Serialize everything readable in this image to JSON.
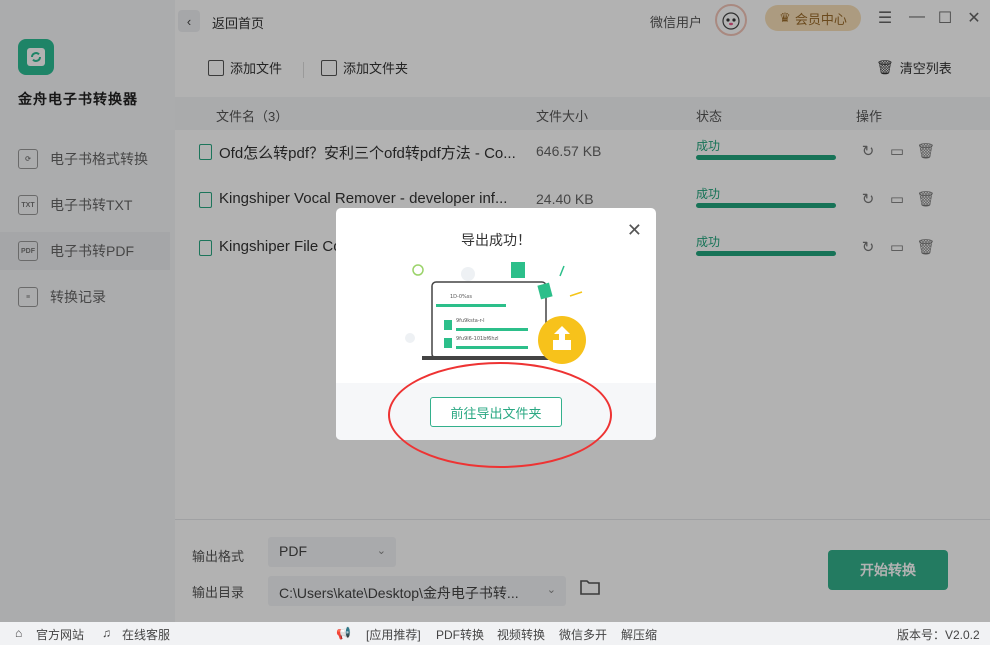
{
  "app": {
    "name": "金舟电子书转换器"
  },
  "sidebar": {
    "items": [
      {
        "label": "电子书格式转换",
        "icon": "refresh-doc-icon"
      },
      {
        "label": "电子书转TXT",
        "icon": "txt-icon",
        "badge": "TXT"
      },
      {
        "label": "电子书转PDF",
        "icon": "pdf-icon",
        "badge": "PDF",
        "active": true
      },
      {
        "label": "转换记录",
        "icon": "history-icon"
      }
    ]
  },
  "topbar": {
    "back_label": "返回首页",
    "user_label": "微信用户",
    "vip_label": "会员中心"
  },
  "toolbar": {
    "add_file": "添加文件",
    "add_folder": "添加文件夹",
    "clear_list": "清空列表"
  },
  "table": {
    "headers": {
      "name": "文件名（3）",
      "size": "文件大小",
      "status": "状态",
      "action": "操作"
    },
    "rows": [
      {
        "name": "Ofd怎么转pdf？安利三个ofd转pdf方法 - Co...",
        "size": "646.57 KB",
        "status": "成功"
      },
      {
        "name": "Kingshiper Vocal Remover - developer inf...",
        "size": "24.40 KB",
        "status": "成功"
      },
      {
        "name": "Kingshiper File Co",
        "size": "",
        "status": "成功"
      }
    ]
  },
  "output": {
    "format_label": "输出格式",
    "format_value": "PDF",
    "dir_label": "输出目录",
    "dir_value": "C:\\Users\\kate\\Desktop\\金舟电子书转...",
    "start_label": "开始转换"
  },
  "statusbar": {
    "website": "官方网站",
    "support": "在线客服",
    "recommend": "[应用推荐]",
    "link1": "PDF转换",
    "link2": "视频转换",
    "link3": "微信多开",
    "link4": "解压缩",
    "version": "版本号：V2.0.2"
  },
  "modal": {
    "title": "导出成功！",
    "button": "前往导出文件夹",
    "illus_lines": [
      "1D-0%ss",
      "9fu9ksta-r-l",
      "9fu9l6-101bf6hzl"
    ]
  },
  "colors": {
    "accent": "#33b08c",
    "success": "#22a57d",
    "vip_bg": "#f6dfb8",
    "annotation": "#ee3333"
  }
}
